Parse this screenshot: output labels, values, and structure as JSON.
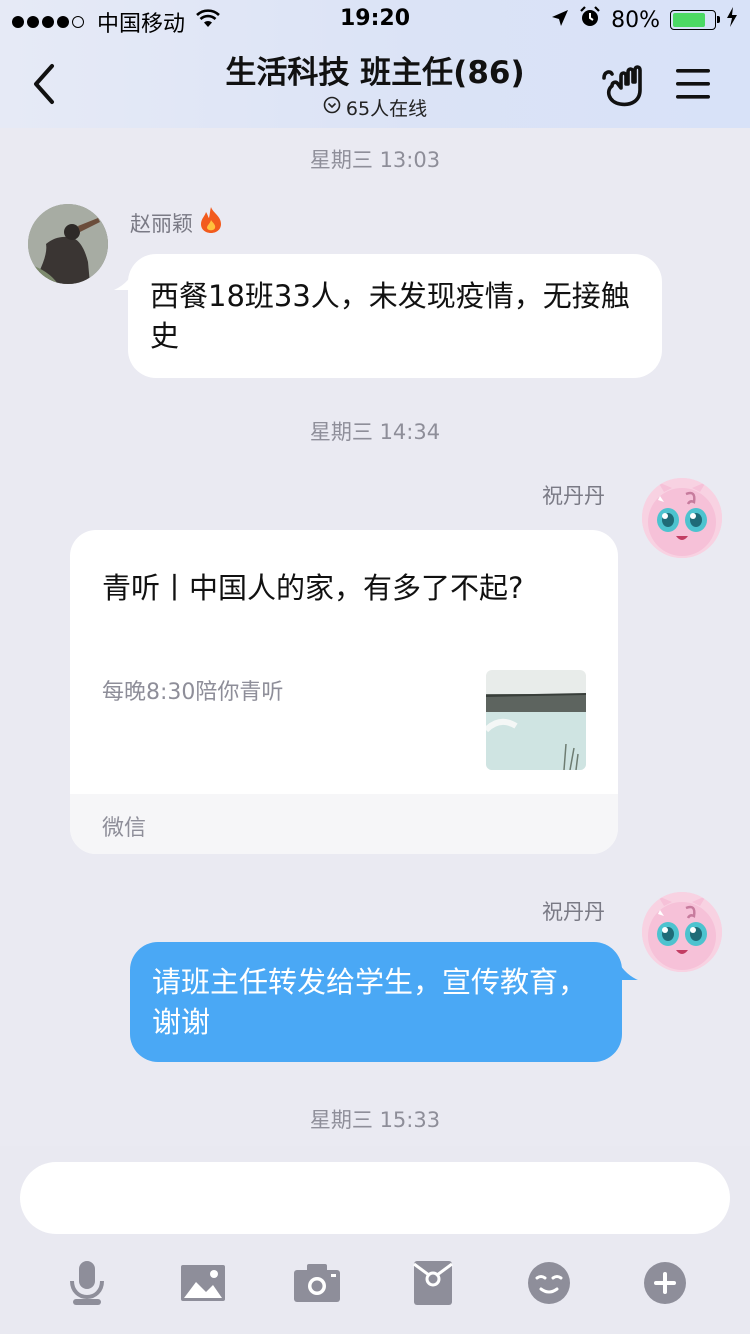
{
  "status_bar": {
    "carrier": "中国移动",
    "time": "19:20",
    "battery": "80%",
    "battery_level": 0.8
  },
  "header": {
    "title": "生活科技 班主任(86)",
    "online_count": "65人在线"
  },
  "messages": {
    "ts1": "星期三 13:03",
    "ts2": "星期三 14:34",
    "ts3": "星期三 15:33",
    "m1": {
      "sender": "赵丽颖",
      "text": "西餐18班33人，未发现疫情，无接触史"
    },
    "m2": {
      "sender": "祝丹丹",
      "card_title": "青听丨中国人的家，有多了不起?",
      "card_desc": "每晚8:30陪你青听",
      "card_source": "微信"
    },
    "m3": {
      "sender": "祝丹丹",
      "text": "请班主任转发给学生，宣传教育，谢谢"
    }
  },
  "colors": {
    "outgoing_bubble": "#4aa8f5",
    "background": "#eaeaf2"
  },
  "toolbar_icons": [
    "microphone-icon",
    "image-icon",
    "camera-icon",
    "red-packet-icon",
    "emoji-icon",
    "plus-icon"
  ]
}
